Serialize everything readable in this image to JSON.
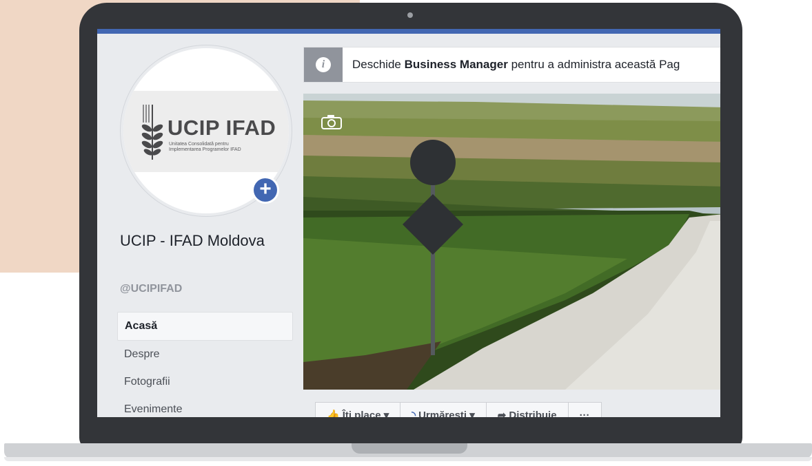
{
  "profile": {
    "logo_title": "UCIP IFAD",
    "logo_subtitle_line1": "Unitatea Consolidată pentru",
    "logo_subtitle_line2": "Implementarea Programelor IFAD",
    "page_name": "UCIP - IFAD Moldova",
    "handle": "@UCIPIFAD"
  },
  "icons": {
    "info": "info-icon",
    "plus": "plus-icon",
    "camera": "camera-icon",
    "like": "thumbs-up-icon",
    "follow": "rss-icon",
    "share": "share-arrow-icon",
    "more": "ellipsis-icon"
  },
  "notice": {
    "prefix": "Deschide ",
    "bold": "Business Manager",
    "suffix": " pentru a administra această Pag"
  },
  "nav": {
    "items": [
      {
        "label": "Acasă",
        "active": true
      },
      {
        "label": "Despre"
      },
      {
        "label": "Fotografii"
      },
      {
        "label": "Evenimente"
      }
    ]
  },
  "actions": {
    "like": "Îți place ▾",
    "follow": "Urmărești ▾",
    "share": "Distribuie",
    "more": "···"
  },
  "colors": {
    "brand_blue": "#4267b2",
    "page_bg": "#e9ebee",
    "laptop": "#333539",
    "peach": "#f0d7c5"
  }
}
